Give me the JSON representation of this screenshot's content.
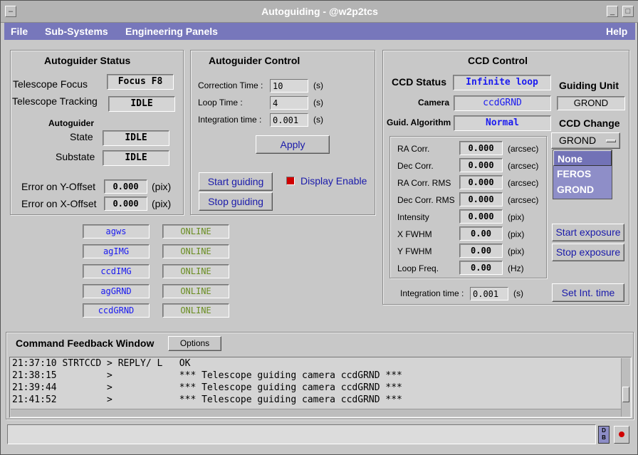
{
  "window": {
    "title": "Autoguiding - @w2p2tcs"
  },
  "menu": {
    "file": "File",
    "subsystems": "Sub-Systems",
    "engineering": "Engineering Panels",
    "help": "Help"
  },
  "status": {
    "title": "Autoguider Status",
    "telescope_focus_label": "Telescope Focus",
    "telescope_focus_value": "Focus F8",
    "telescope_tracking_label": "Telescope Tracking",
    "telescope_tracking_value": "IDLE",
    "autoguider_label": "Autoguider",
    "state_label": "State",
    "state_value": "IDLE",
    "substate_label": "Substate",
    "substate_value": "IDLE",
    "error_y_label": "Error on Y-Offset",
    "error_y_value": "0.000",
    "error_x_label": "Error on X-Offset",
    "error_x_value": "0.000",
    "pix": "(pix)"
  },
  "control": {
    "title": "Autoguider Control",
    "correction_label": "Correction Time :",
    "correction_value": "10",
    "loop_label": "Loop Time :",
    "loop_value": "4",
    "integration_label": "Integration time :",
    "integration_value": "0.001",
    "unit_s": "(s)",
    "apply": "Apply",
    "start_guiding": "Start guiding",
    "stop_guiding": "Stop guiding",
    "display_enable": "Display Enable"
  },
  "processes": [
    {
      "name": "agws",
      "status": "ONLINE"
    },
    {
      "name": "agIMG",
      "status": "ONLINE"
    },
    {
      "name": "ccdIMG",
      "status": "ONLINE"
    },
    {
      "name": "agGRND",
      "status": "ONLINE"
    },
    {
      "name": "ccdGRND",
      "status": "ONLINE"
    }
  ],
  "ccd": {
    "title": "CCD Control",
    "status_label": "CCD Status",
    "status_value": "Infinite loop",
    "camera_label": "Camera",
    "camera_value": "ccdGRND",
    "algorithm_label": "Guid. Algorithm",
    "algorithm_value": "Normal",
    "guiding_unit_label": "Guiding Unit",
    "guiding_unit_value": "GROND",
    "ccd_change_label": "CCD Change",
    "ccd_change_value": "GROND",
    "options": [
      "None",
      "FEROS",
      "GROND"
    ],
    "measurements": [
      {
        "label": "RA Corr.",
        "value": "0.000",
        "unit": "(arcsec)"
      },
      {
        "label": "Dec Corr.",
        "value": "0.000",
        "unit": "(arcsec)"
      },
      {
        "label": "RA Corr. RMS",
        "value": "0.000",
        "unit": "(arcsec)"
      },
      {
        "label": "Dec Corr. RMS",
        "value": "0.000",
        "unit": "(arcsec)"
      },
      {
        "label": "Intensity",
        "value": "0.000",
        "unit": "(pix)"
      },
      {
        "label": "X  FWHM",
        "value": "0.00",
        "unit": "(pix)"
      },
      {
        "label": "Y  FWHM",
        "value": "0.00",
        "unit": "(pix)"
      },
      {
        "label": "Loop Freq.",
        "value": "0.00",
        "unit": "(Hz)"
      }
    ],
    "start_exposure": "Start exposure",
    "stop_exposure": "Stop exposure",
    "integration_label": "Integration time :",
    "integration_value": "0.001",
    "unit_s": "(s)",
    "set_int_time": "Set Int. time"
  },
  "feedback": {
    "title": "Command Feedback Window",
    "options": "Options",
    "lines": [
      "21:37:10 STRTCCD > REPLY/ L   OK",
      "21:38:15         >            *** Telescope guiding camera ccdGRND ***",
      "21:39:44         >            *** Telescope guiding camera ccdGRND ***",
      "21:41:52         >            *** Telescope guiding camera ccdGRND ***"
    ],
    "command_value": "",
    "db_label": "D B"
  },
  "colors": {
    "menu": "#7777bb",
    "link": "#1a1aaa",
    "value_blue": "#1a1af0",
    "online": "#6b8e23",
    "indicator": "#d00000"
  }
}
